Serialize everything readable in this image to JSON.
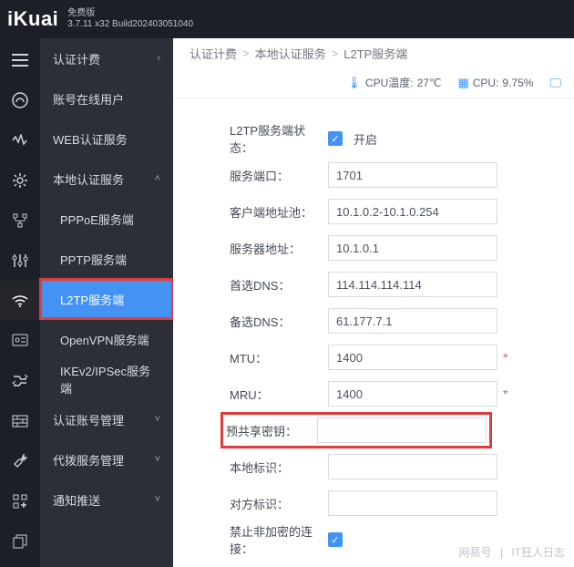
{
  "app": {
    "logo": "iKuai",
    "edition": "免费版",
    "version": "3.7.11 x32 Build202403051040"
  },
  "rail_icons": [
    "menu",
    "dashboard",
    "monitor",
    "settings",
    "network",
    "tuning",
    "wifi",
    "auth",
    "route",
    "firewall",
    "wrench",
    "apps",
    "copy"
  ],
  "sidebar": {
    "items": [
      {
        "label": "认证计费",
        "caret": "‹"
      },
      {
        "label": "账号在线用户"
      },
      {
        "label": "WEB认证服务"
      },
      {
        "label": "本地认证服务",
        "caret": "˄"
      },
      {
        "label": "PPPoE服务端",
        "sub": true
      },
      {
        "label": "PPTP服务端",
        "sub": true
      },
      {
        "label": "L2TP服务端",
        "sub": true,
        "active": true,
        "highlight": true
      },
      {
        "label": "OpenVPN服务端",
        "sub": true
      },
      {
        "label": "IKEv2/IPSec服务端",
        "sub": true
      },
      {
        "label": "认证账号管理",
        "caret": "˅"
      },
      {
        "label": "代拨服务管理",
        "caret": "˅"
      },
      {
        "label": "通知推送",
        "caret": "˅"
      }
    ]
  },
  "breadcrumbs": [
    "认证计费",
    "本地认证服务",
    "L2TP服务端"
  ],
  "stats": {
    "temp_label": "CPU温度:",
    "temp": "27℃",
    "cpu_label": "CPU:",
    "cpu": "9.75%"
  },
  "form": {
    "rows": [
      {
        "label": "L2TP服务端状态：",
        "type": "check",
        "text": "开启"
      },
      {
        "label": "服务端口：",
        "value": "1701"
      },
      {
        "label": "客户端地址池：",
        "value": "10.1.0.2-10.1.0.254"
      },
      {
        "label": "服务器地址：",
        "value": "10.1.0.1"
      },
      {
        "label": "首选DNS：",
        "value": "114.114.114.114"
      },
      {
        "label": "备选DNS：",
        "value": "61.177.7.1"
      },
      {
        "label": "MTU：",
        "value": "1400",
        "req": true
      },
      {
        "label": "MRU：",
        "value": "1400",
        "req": true
      },
      {
        "label": "预共享密钥：",
        "blur": true,
        "highlight": true
      },
      {
        "label": "本地标识：",
        "value": ""
      },
      {
        "label": "对方标识：",
        "value": ""
      },
      {
        "label": "禁止非加密的连接：",
        "type": "check",
        "text": ""
      }
    ]
  },
  "watermark": {
    "a": "网易号",
    "b": "IT狂人日志"
  }
}
